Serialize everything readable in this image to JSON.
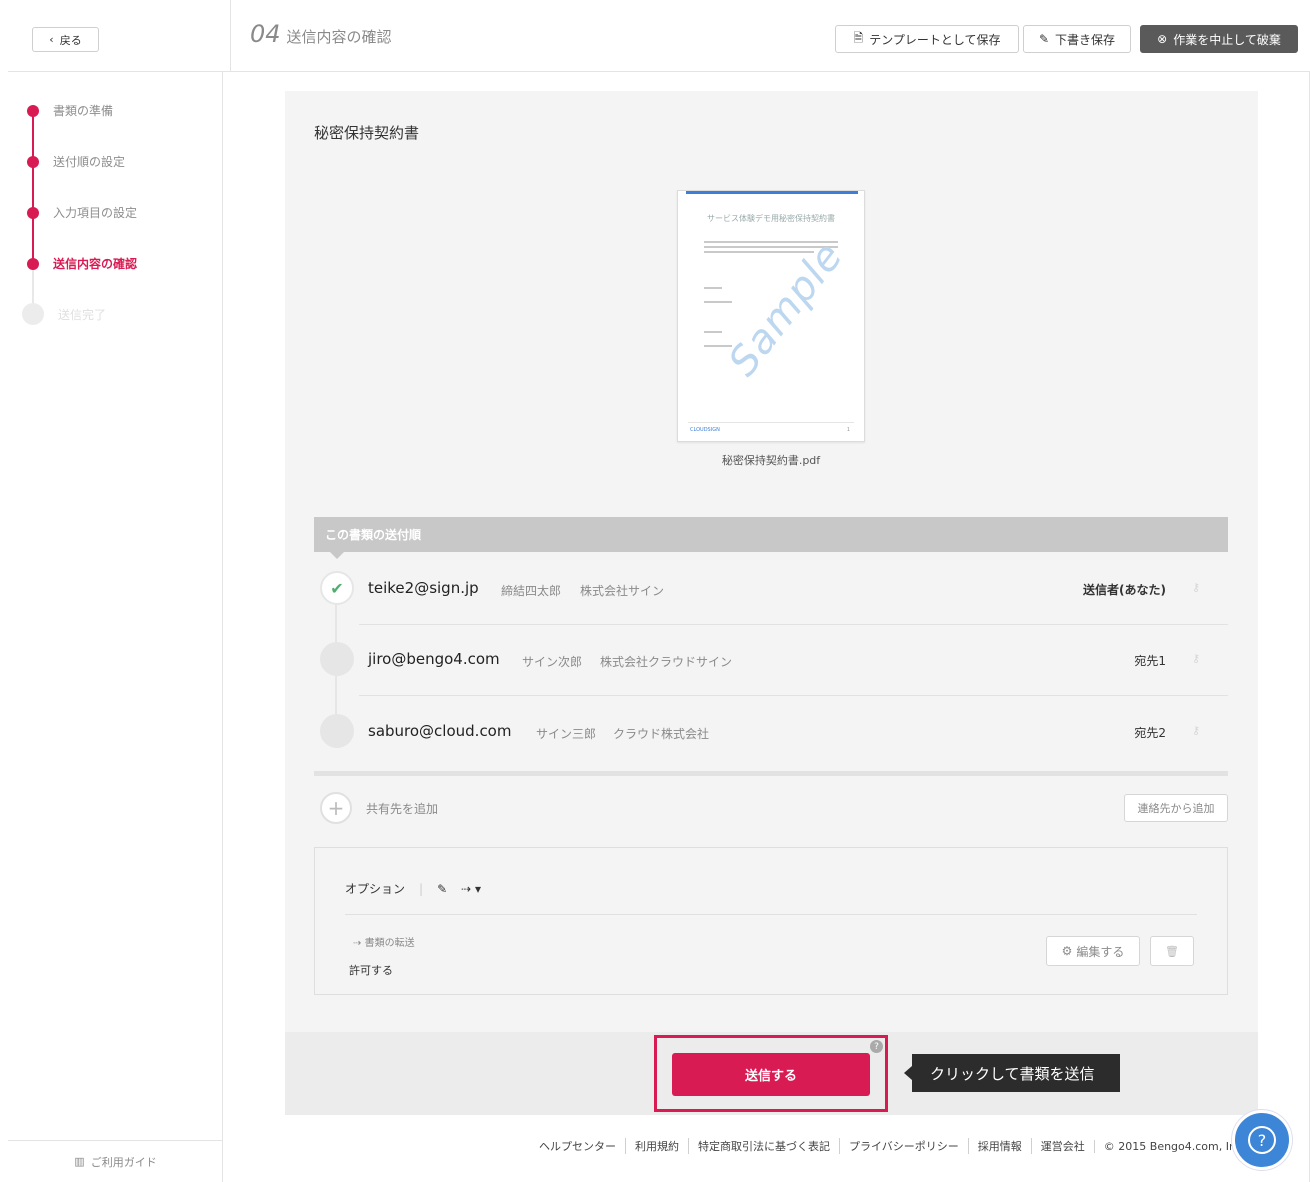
{
  "header": {
    "back_label": "戻る",
    "step_number": "04",
    "step_title": "送信内容の確認",
    "save_template_label": "テンプレートとして保存",
    "save_draft_label": "下書き保存",
    "abort_label": "作業を中止して破棄"
  },
  "sidebar": {
    "steps": [
      {
        "label": "書類の準備",
        "state": "done"
      },
      {
        "label": "送付順の設定",
        "state": "done"
      },
      {
        "label": "入力項目の設定",
        "state": "done"
      },
      {
        "label": "送信内容の確認",
        "state": "active"
      },
      {
        "label": "送信完了",
        "state": "future"
      }
    ],
    "guide_label": "ご利用ガイド"
  },
  "document": {
    "title": "秘密保持契約書",
    "preview_heading": "サービス体験デモ用秘密保持契約書",
    "watermark": "Sample",
    "preview_footer": "CLOUDSIGN",
    "preview_page": "1",
    "filename": "秘密保持契約書.pdf"
  },
  "order": {
    "heading": "この書類の送付順",
    "recipients": [
      {
        "email": "teike2@sign.jp",
        "name": "締結四太郎",
        "company": "株式会社サイン",
        "role": "送信者(あなた)",
        "done": true
      },
      {
        "email": "jiro@bengo4.com",
        "name": "サイン次郎",
        "company": "株式会社クラウドサイン",
        "role": "宛先1",
        "done": false
      },
      {
        "email": "saburo@cloud.com",
        "name": "サイン三郎",
        "company": "クラウド株式会社",
        "role": "宛先2",
        "done": false
      }
    ],
    "add_share_label": "共有先を追加",
    "add_from_contacts_label": "連絡先から追加"
  },
  "options": {
    "title": "オプション",
    "forwarding_label": "書類の転送",
    "forwarding_value": "許可する",
    "edit_label": "編集する"
  },
  "send": {
    "button_label": "送信する",
    "tooltip": "クリックして書類を送信"
  },
  "footer": {
    "links": [
      "ヘルプセンター",
      "利用規約",
      "特定商取引法に基づく表記",
      "プライバシーポリシー",
      "採用情報",
      "運営会社",
      "© 2015 Bengo4.com, Inc."
    ]
  },
  "colors": {
    "accent": "#d81b53",
    "help_fab": "#3d85d6",
    "check": "#4caf6e"
  }
}
